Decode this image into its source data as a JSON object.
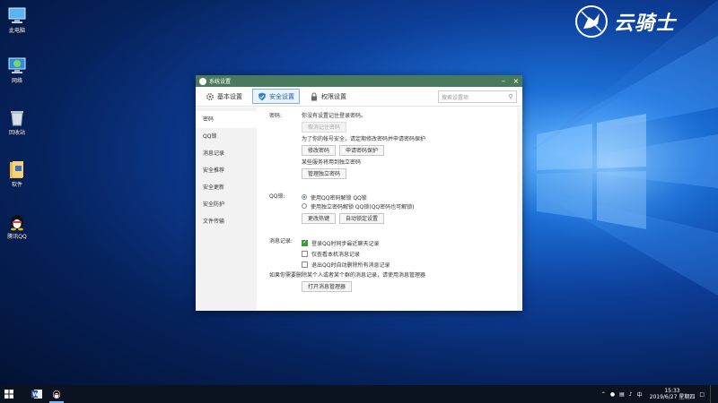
{
  "desktop": {
    "icons": [
      {
        "label": "此电脑"
      },
      {
        "label": "网络"
      },
      {
        "label": "回收站"
      },
      {
        "label": "软件"
      },
      {
        "label": "腾讯QQ"
      }
    ]
  },
  "watermark": {
    "text": "云骑士"
  },
  "dialog": {
    "title": "系统设置",
    "tabs": [
      {
        "label": "基本设置",
        "icon": "gear-icon"
      },
      {
        "label": "安全设置",
        "icon": "shield-icon"
      },
      {
        "label": "权限设置",
        "icon": "lock-icon"
      }
    ],
    "search_placeholder": "搜索设置项",
    "sidebar": [
      {
        "label": "密码"
      },
      {
        "label": "QQ锁"
      },
      {
        "label": "消息记录"
      },
      {
        "label": "安全推荐"
      },
      {
        "label": "安全更新"
      },
      {
        "label": "安全防护"
      },
      {
        "label": "文件传输"
      }
    ],
    "password": {
      "label": "密码:",
      "status_text": "你没有设置记住登录密码。",
      "cancel_remember_btn": "取消记住密码",
      "protect_text": "为了你的帐号安全，请定期修改密码并申请密码保护",
      "change_btn": "修改密码",
      "apply_protect_btn": "申请密码保护",
      "independent_text": "某些服务将用到独立密码",
      "manage_independent_btn": "管理独立密码"
    },
    "qqlock": {
      "label": "QQ锁:",
      "option1": "使用QQ密码解锁 QQ锁",
      "option2": "使用独立密码解锁 QQ锁(QQ密码也可解锁)",
      "hotkey_btn": "更改热键",
      "autolock_btn": "自动锁定设置"
    },
    "messages": {
      "label": "消息记录:",
      "check1": "登录QQ时同步最近聊天记录",
      "check2": "仅查看本机消息记录",
      "check3": "退出QQ时自动删除所有消息记录",
      "note": "如果你需要删除某个人或者某个群的消息记录，请使用消息管理器",
      "open_manager_btn": "打开消息管理器"
    }
  },
  "taskbar": {
    "tray_ime": "中",
    "time": "15:33",
    "date": "2019/6/27 星期四"
  },
  "colors": {
    "titlebar": "#4a7a5e",
    "active_tab": "#1a5fb4",
    "taskbar": "#0b1220"
  }
}
